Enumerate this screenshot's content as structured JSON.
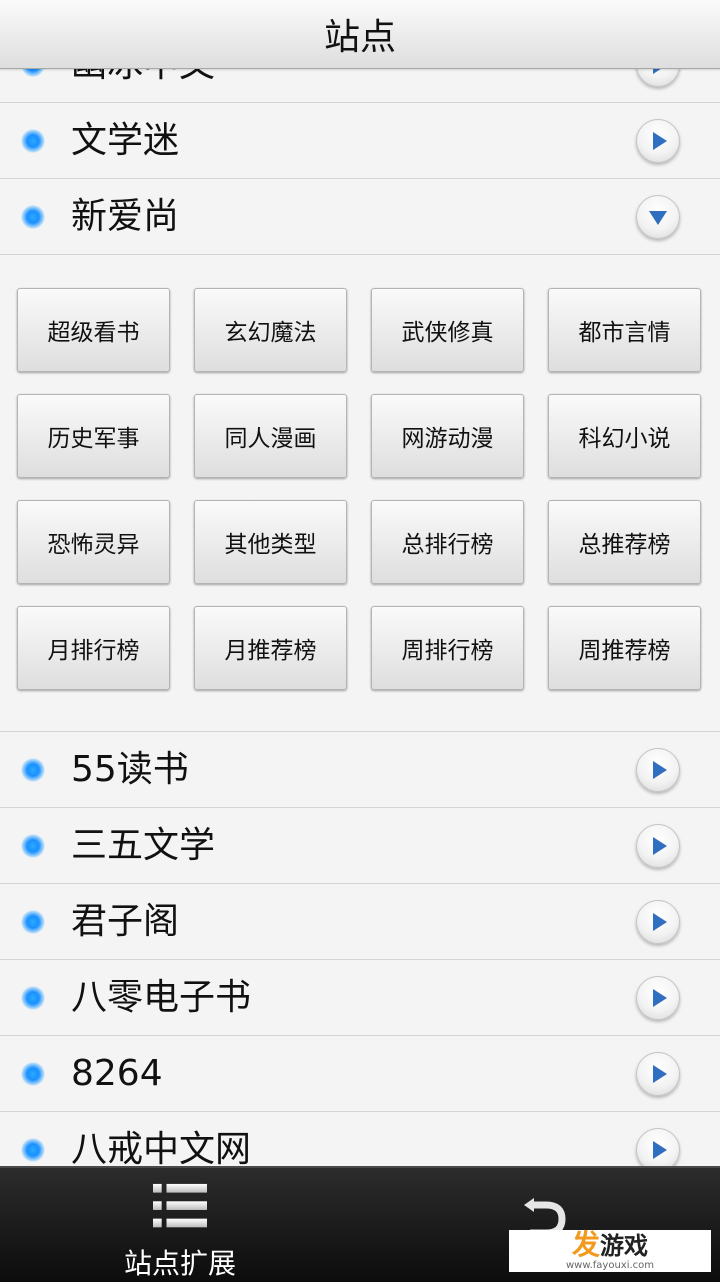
{
  "title": "站点",
  "sites_top": [
    {
      "label": "幽冰中文"
    },
    {
      "label": "文学迷"
    },
    {
      "label": "新爱尚"
    }
  ],
  "categories": [
    "超级看书",
    "玄幻魔法",
    "武侠修真",
    "都市言情",
    "历史军事",
    "同人漫画",
    "网游动漫",
    "科幻小说",
    "恐怖灵异",
    "其他类型",
    "总排行榜",
    "总推荐榜",
    "月排行榜",
    "月推荐榜",
    "周排行榜",
    "周推荐榜"
  ],
  "sites_bottom": [
    {
      "label": "55读书"
    },
    {
      "label": "三五文学"
    },
    {
      "label": "君子阁"
    },
    {
      "label": "八零电子书"
    },
    {
      "label": "8264"
    },
    {
      "label": "八戒中文网"
    }
  ],
  "bottom_nav": {
    "left_label": "站点扩展",
    "left_icon": "list-icon",
    "right_icon": "back-arrow-icon"
  },
  "watermark": {
    "brand_a": "发",
    "brand_b": "游戏",
    "url": "www.fayouxi.com"
  },
  "colors": {
    "bullet": "#1a90ff",
    "arrow": "#2f6fc0",
    "bottom_bar": "#1a1a1a"
  }
}
